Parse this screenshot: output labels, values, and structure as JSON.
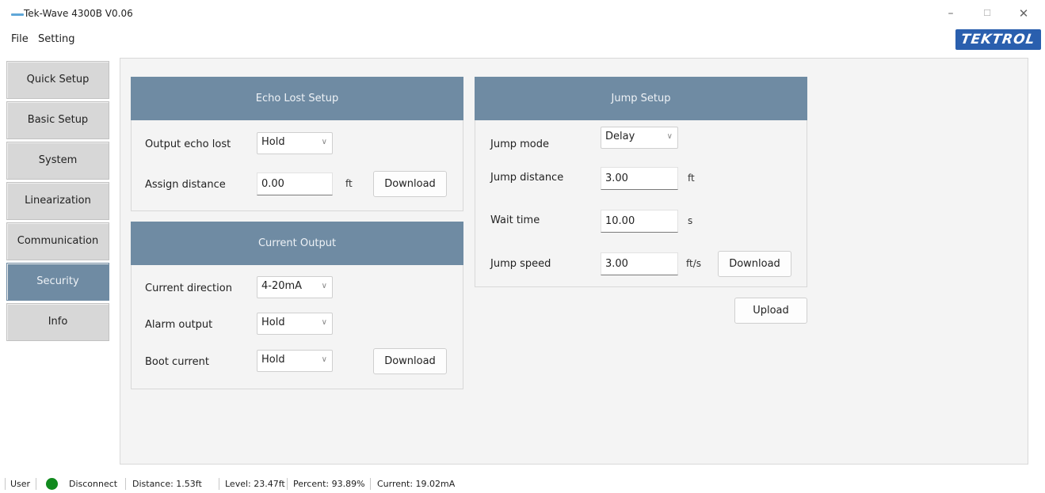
{
  "window": {
    "title": "Tek-Wave 4300B V0.06",
    "min": "–",
    "max": "☐",
    "close": "✕"
  },
  "menu": {
    "file": "File",
    "setting": "Setting"
  },
  "logo": "TEKTROL",
  "sidebar": {
    "items": [
      {
        "label": "Quick Setup"
      },
      {
        "label": "Basic Setup"
      },
      {
        "label": "System"
      },
      {
        "label": "Linearization"
      },
      {
        "label": "Communication"
      },
      {
        "label": "Security",
        "active": true
      },
      {
        "label": "Info"
      }
    ]
  },
  "echo_lost": {
    "title": "Echo Lost Setup",
    "output_label": "Output echo lost",
    "output_value": "Hold",
    "assign_label": "Assign distance",
    "assign_value": "0.00",
    "assign_unit": "ft",
    "download": "Download"
  },
  "current_output": {
    "title": "Current Output",
    "direction_label": "Current direction",
    "direction_value": "4-20mA",
    "alarm_label": "Alarm output",
    "alarm_value": "Hold",
    "boot_label": "Boot current",
    "boot_value": "Hold",
    "download": "Download"
  },
  "jump": {
    "title": "Jump Setup",
    "mode_label": "Jump mode",
    "mode_value": "Delay",
    "distance_label": "Jump distance",
    "distance_value": "3.00",
    "distance_unit": "ft",
    "wait_label": "Wait time",
    "wait_value": "10.00",
    "wait_unit": "s",
    "speed_label": "Jump speed",
    "speed_value": "3.00",
    "speed_unit": "ft/s",
    "download": "Download"
  },
  "upload": "Upload",
  "status": {
    "user": "User",
    "connection": "Disconnect",
    "connection_color": "#118a1e",
    "distance": "Distance:  1.53ft",
    "level": "Level:  23.47ft",
    "percent": "Percent:  93.89%",
    "current": "Current:  19.02mA"
  },
  "icons": {
    "dropdown": "chevron-down-icon"
  }
}
